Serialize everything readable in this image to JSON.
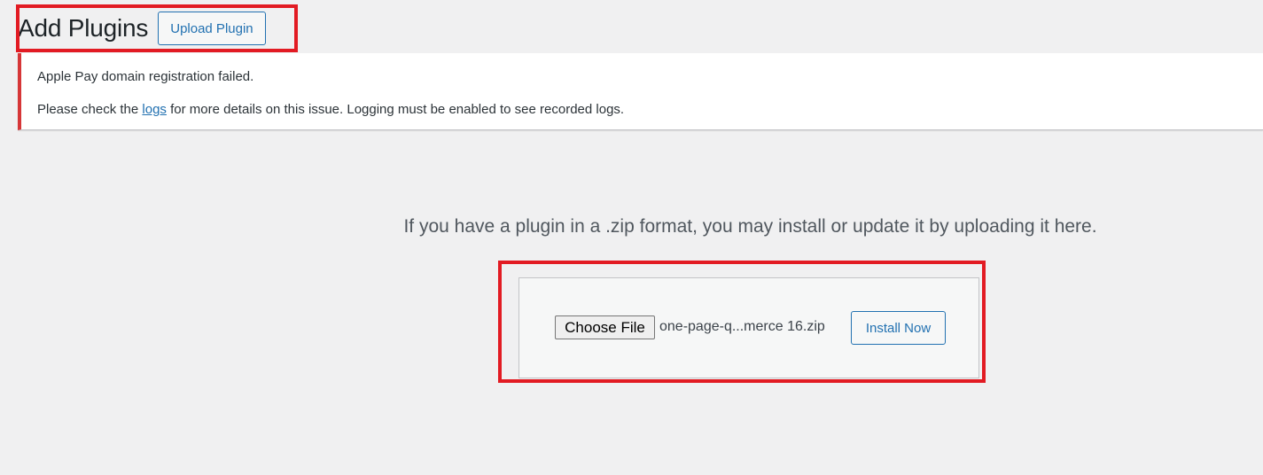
{
  "header": {
    "title": "Add Plugins",
    "upload_button_label": "Upload Plugin"
  },
  "notice": {
    "line1": "Apple Pay domain registration failed.",
    "line2_prefix": "Please check the ",
    "line2_link": "logs",
    "line2_suffix": " for more details on this issue. Logging must be enabled to see recorded logs."
  },
  "upload": {
    "help_text": "If you have a plugin in a .zip format, you may install or update it by uploading it here.",
    "choose_file_label": "Choose File",
    "file_name": "one-page-q...merce 16.zip",
    "install_button_label": "Install Now"
  },
  "colors": {
    "highlight": "#e21b23",
    "accent": "#2271b1",
    "notice_error": "#d63638",
    "background": "#f0f0f1"
  }
}
